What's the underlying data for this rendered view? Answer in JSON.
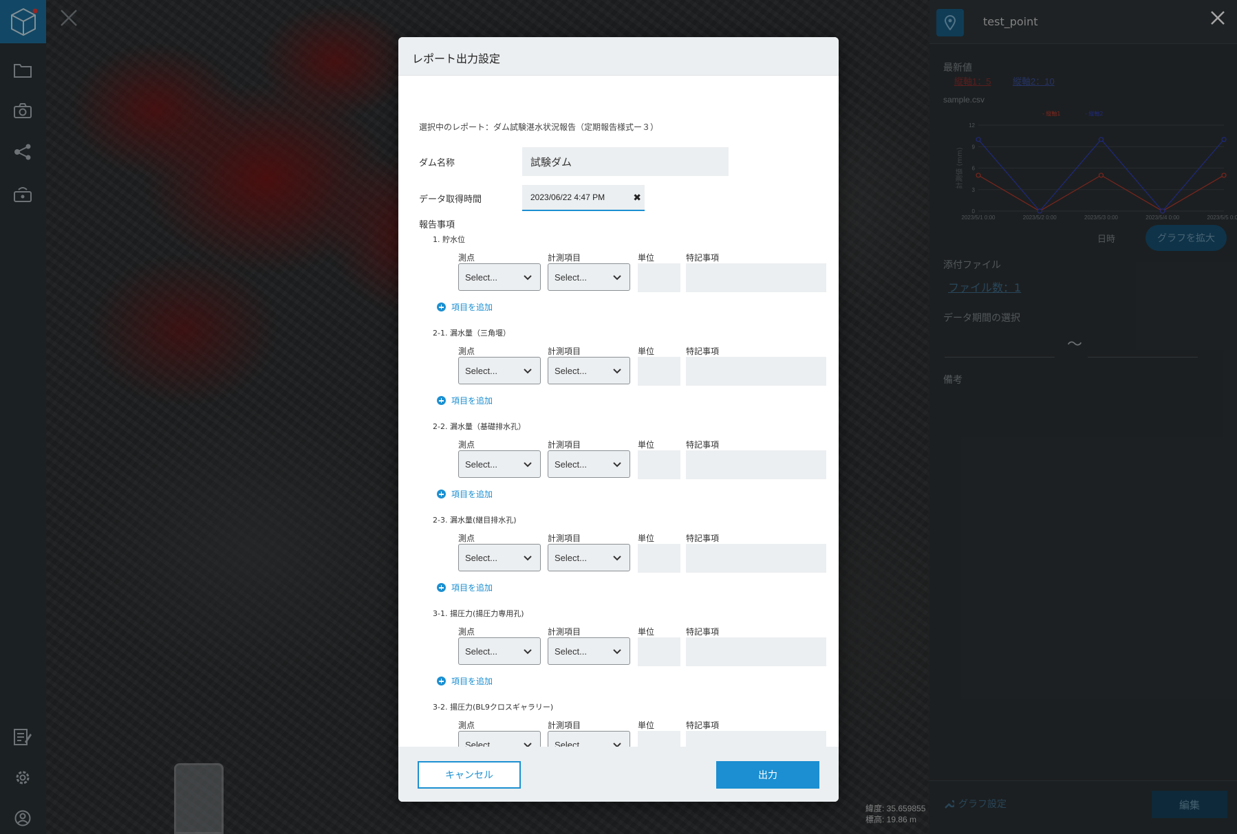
{
  "right_panel": {
    "point_name": "test_point",
    "latest_label": "最新値",
    "latest_links": [
      {
        "label": "縦軸1：5",
        "color": "#8a2f2f"
      },
      {
        "label": "縦軸2：10",
        "color": "#3a4f9a"
      }
    ],
    "file_name": "sample.csv",
    "chart_xlabel": "日時",
    "enlarge_button": "グラフを拡大",
    "attachment_label": "添付ファイル",
    "file_count": "ファイル数：1",
    "period_label": "データ期間の選択",
    "tilde": "〜",
    "remarks_label": "備考",
    "graph_settings": "グラフ設定",
    "edit_button": "編集"
  },
  "chart_data": {
    "type": "line",
    "x": [
      "2023/5/1 0:00",
      "2023/5/2 0:00",
      "2023/5/3 0:00",
      "2023/5/4 0:00",
      "2023/5/5 0:00"
    ],
    "categories": [
      "2023/5/1 0:00",
      "2023/5/2 0:00",
      "2023/5/3 0:00",
      "2023/5/4 0:00",
      "2023/5/5 0:00"
    ],
    "series": [
      {
        "name": "縦軸1",
        "color": "#c0392b",
        "values": [
          5,
          0,
          5,
          0,
          5
        ]
      },
      {
        "name": "縦軸2",
        "color": "#2e3fbf",
        "values": [
          10,
          0,
          10,
          0,
          10
        ]
      }
    ],
    "ylabel": "計測値 (mm)",
    "xlabel": "日時",
    "ylim": [
      0,
      12
    ],
    "yticks": [
      "0",
      "3",
      "6",
      "9",
      "12"
    ],
    "grid": true,
    "legend": "top-right"
  },
  "map": {
    "coord_lat": "緯度: 35.659855",
    "coord_alt": "標高: 19.86 m"
  },
  "modal": {
    "title": "レポート出力設定",
    "selected_report": "選択中のレポート：ダム試験湛水状況報告（定期報告様式ー３）",
    "dam_name_label": "ダム名称",
    "dam_name_value": "試験ダム",
    "datetime_label": "データ取得時間",
    "datetime_value": "2023/06/22 4:47 PM",
    "report_items_label": "報告事項",
    "columns": {
      "point": "測点",
      "measure": "計測項目",
      "unit": "単位",
      "remark": "特記事項"
    },
    "select_placeholder": "Select...",
    "add_item_label": "項目を追加",
    "sections": [
      {
        "title": "1. 貯水位"
      },
      {
        "title": "2-1. 漏水量（三角堰）"
      },
      {
        "title": "2-2. 漏水量（基礎排水孔）"
      },
      {
        "title": "2-3. 漏水量(継目排水孔)"
      },
      {
        "title": "3-1. 揚圧力(揚圧力専用孔)"
      },
      {
        "title": "3-2. 揚圧力(BL9クロスギャラリー)"
      }
    ],
    "cancel_button": "キャンセル",
    "output_button": "出力"
  }
}
